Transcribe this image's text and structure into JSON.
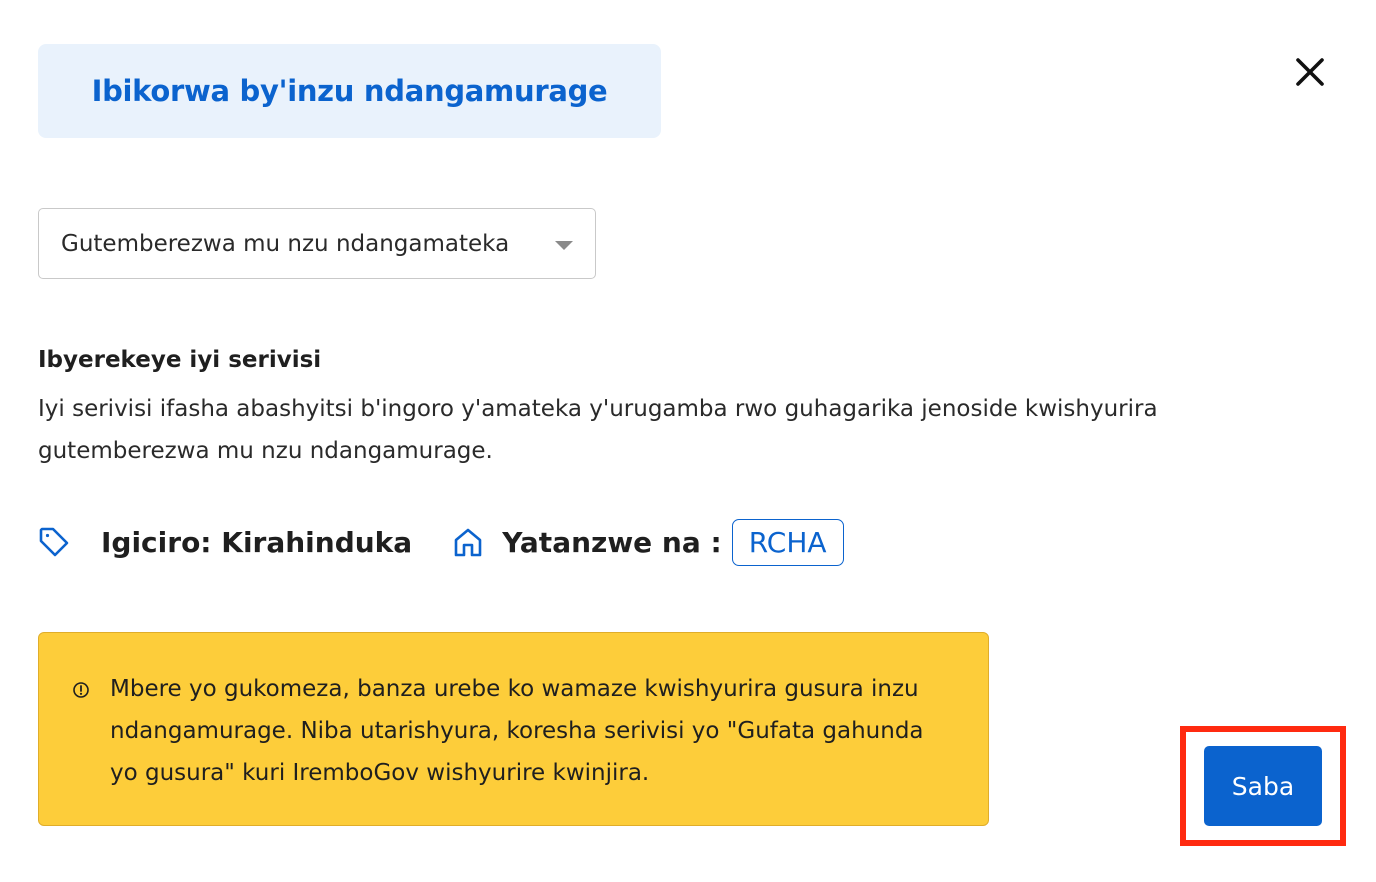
{
  "header": {
    "title": "Ibikorwa by'inzu ndangamurage"
  },
  "service_select": {
    "selected_value": "Gutemberezwa mu nzu ndangamateka"
  },
  "about": {
    "heading": "Ibyerekeye iyi serivisi",
    "description": "Iyi serivisi ifasha abashyitsi b'ingoro y'amateka y'urugamba rwo guhagarika jenoside kwishyurira gutemberezwa mu nzu ndangamurage."
  },
  "meta": {
    "price": "Igiciro: Kirahinduka",
    "owner_label": "Yatanzwe na :",
    "owner": "RCHA"
  },
  "notice": {
    "text": "Mbere yo gukomeza, banza urebe ko wamaze kwishyurira gusura inzu ndangamurage. Niba utarishyura, koresha serivisi yo \"Gufata gahunda yo gusura\" kuri IremboGov wishyurire kwinjira."
  },
  "actions": {
    "apply_label": "Saba"
  },
  "icons": {
    "close": "close-icon",
    "dropdown": "chevron-down-icon",
    "price": "tag-icon",
    "owner": "home-icon",
    "notice": "info-icon"
  },
  "colors": {
    "brand_blue": "#0b63ce",
    "title_bg": "#e9f2fc",
    "notice_bg": "#fdcd3a",
    "highlight": "#ff2a10"
  }
}
